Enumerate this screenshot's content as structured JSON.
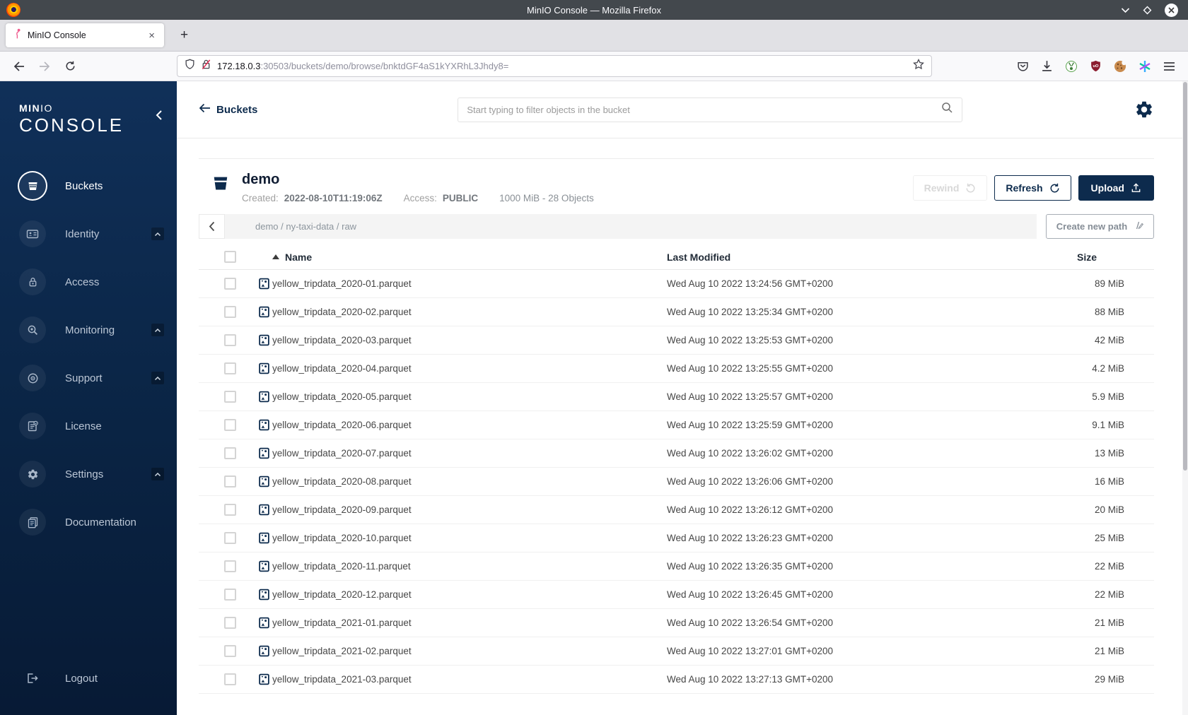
{
  "theme": {
    "navy": "#0d2b4d",
    "sidebar_top": "#103059",
    "sidebar_bottom": "#071a35",
    "titlebar": "#43484d",
    "lock_slash_red": "#e22850"
  },
  "browser": {
    "window_title": "MinIO Console — Mozilla Firefox",
    "tab": {
      "title": "MinIO Console",
      "close_label": "×"
    },
    "new_tab_label": "+",
    "url": {
      "host": "172.18.0.3",
      "rest": ":30503/buckets/demo/browse/bnktdGF4aS1kYXRhL3Jhdy8="
    }
  },
  "sidebar": {
    "logo": {
      "part1": "MIN",
      "part2": "IO",
      "subtitle": "CONSOLE"
    },
    "items": [
      {
        "label": "Buckets"
      },
      {
        "label": "Identity"
      },
      {
        "label": "Access"
      },
      {
        "label": "Monitoring"
      },
      {
        "label": "Support"
      },
      {
        "label": "License"
      },
      {
        "label": "Settings"
      },
      {
        "label": "Documentation"
      }
    ],
    "logout_label": "Logout"
  },
  "header": {
    "back_label": "Buckets",
    "search_placeholder": "Start typing to filter objects in the bucket"
  },
  "bucket": {
    "name": "demo",
    "created_label": "Created:",
    "created_value": "2022-08-10T11:19:06Z",
    "access_label": "Access:",
    "access_value": "PUBLIC",
    "summary": "1000 MiB - 28 Objects",
    "rewind_label": "Rewind",
    "refresh_label": "Refresh",
    "upload_label": "Upload"
  },
  "browse": {
    "path": "demo / ny-taxi-data / raw",
    "create_path_label": "Create new path"
  },
  "table": {
    "columns": [
      "Name",
      "Last Modified",
      "Size"
    ],
    "rows": [
      {
        "name": "yellow_tripdata_2020-01.parquet",
        "modified": "Wed Aug 10 2022 13:24:56 GMT+0200",
        "size": "89 MiB"
      },
      {
        "name": "yellow_tripdata_2020-02.parquet",
        "modified": "Wed Aug 10 2022 13:25:34 GMT+0200",
        "size": "88 MiB"
      },
      {
        "name": "yellow_tripdata_2020-03.parquet",
        "modified": "Wed Aug 10 2022 13:25:53 GMT+0200",
        "size": "42 MiB"
      },
      {
        "name": "yellow_tripdata_2020-04.parquet",
        "modified": "Wed Aug 10 2022 13:25:55 GMT+0200",
        "size": "4.2 MiB"
      },
      {
        "name": "yellow_tripdata_2020-05.parquet",
        "modified": "Wed Aug 10 2022 13:25:57 GMT+0200",
        "size": "5.9 MiB"
      },
      {
        "name": "yellow_tripdata_2020-06.parquet",
        "modified": "Wed Aug 10 2022 13:25:59 GMT+0200",
        "size": "9.1 MiB"
      },
      {
        "name": "yellow_tripdata_2020-07.parquet",
        "modified": "Wed Aug 10 2022 13:26:02 GMT+0200",
        "size": "13 MiB"
      },
      {
        "name": "yellow_tripdata_2020-08.parquet",
        "modified": "Wed Aug 10 2022 13:26:06 GMT+0200",
        "size": "16 MiB"
      },
      {
        "name": "yellow_tripdata_2020-09.parquet",
        "modified": "Wed Aug 10 2022 13:26:12 GMT+0200",
        "size": "20 MiB"
      },
      {
        "name": "yellow_tripdata_2020-10.parquet",
        "modified": "Wed Aug 10 2022 13:26:23 GMT+0200",
        "size": "25 MiB"
      },
      {
        "name": "yellow_tripdata_2020-11.parquet",
        "modified": "Wed Aug 10 2022 13:26:35 GMT+0200",
        "size": "22 MiB"
      },
      {
        "name": "yellow_tripdata_2020-12.parquet",
        "modified": "Wed Aug 10 2022 13:26:45 GMT+0200",
        "size": "22 MiB"
      },
      {
        "name": "yellow_tripdata_2021-01.parquet",
        "modified": "Wed Aug 10 2022 13:26:54 GMT+0200",
        "size": "21 MiB"
      },
      {
        "name": "yellow_tripdata_2021-02.parquet",
        "modified": "Wed Aug 10 2022 13:27:01 GMT+0200",
        "size": "21 MiB"
      },
      {
        "name": "yellow_tripdata_2021-03.parquet",
        "modified": "Wed Aug 10 2022 13:27:13 GMT+0200",
        "size": "29 MiB"
      }
    ]
  }
}
